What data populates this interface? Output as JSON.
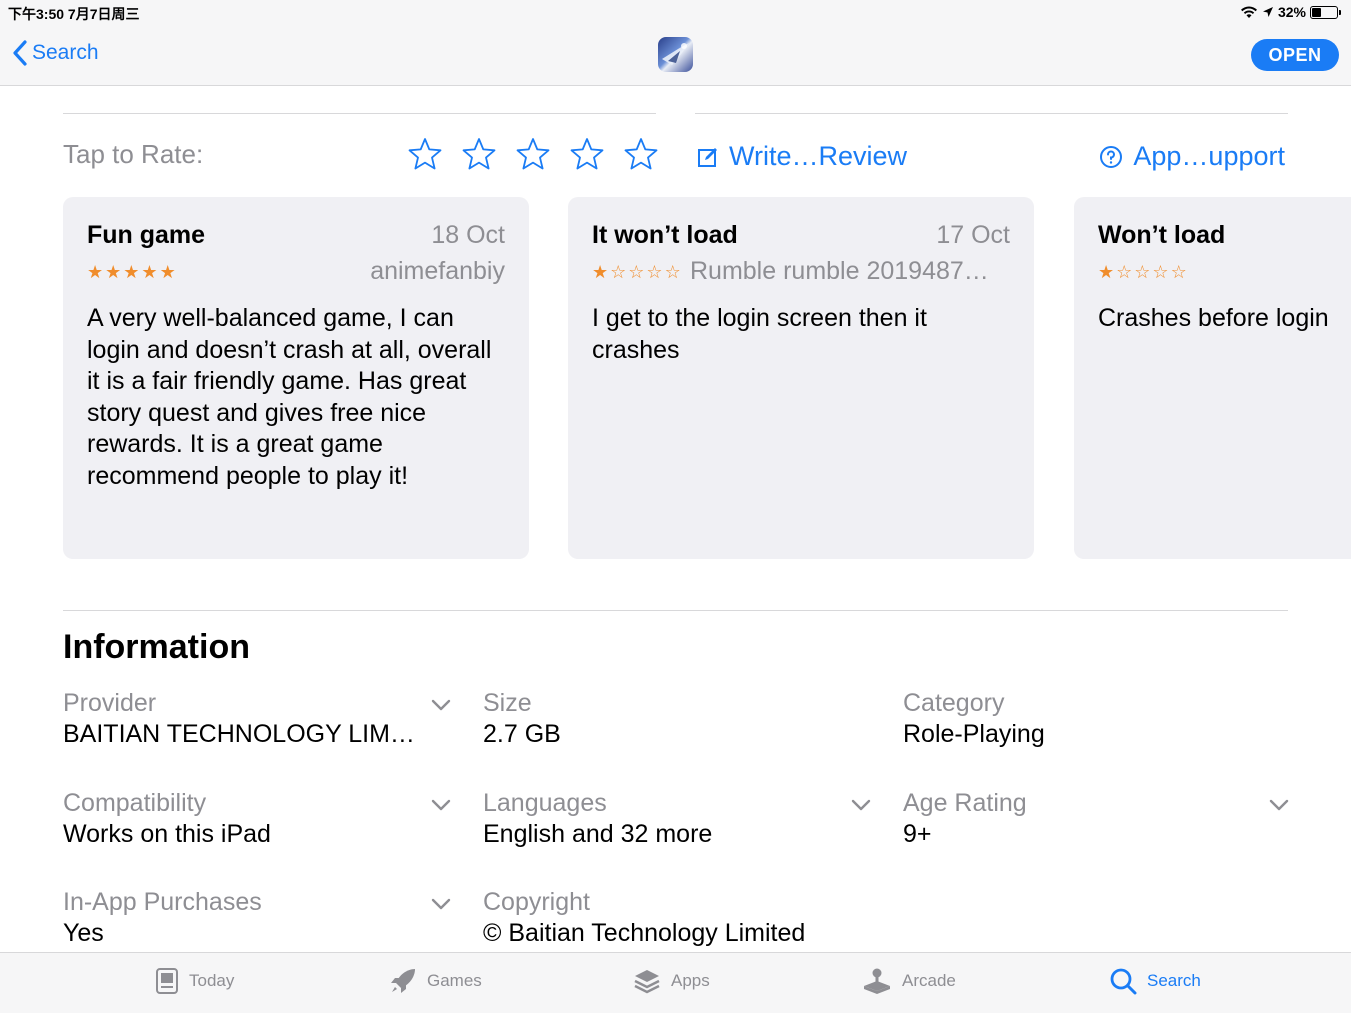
{
  "status": {
    "time": "下午3:50   7月7日周三",
    "battery": "32%"
  },
  "nav": {
    "back_label": "Search",
    "open_label": "OPEN"
  },
  "rate": {
    "tap_label": "Tap to Rate:",
    "write_review": "Write…Review",
    "app_support": "App…upport"
  },
  "reviews": [
    {
      "title": "Fun game",
      "date": "18 Oct",
      "author": "animefanbiy",
      "rating": 5,
      "body": "A very well-balanced game, I can login and doesn’t crash at all, overall it is a fair friendly game. Has great story quest and gives free nice rewards. It is a great game recommend people to play it!"
    },
    {
      "title": "It won’t load",
      "date": "17 Oct",
      "author": "Rumble rumble 2019487…",
      "rating": 1,
      "body": "I get to the login screen then it crashes"
    },
    {
      "title": "Won’t load",
      "date": "",
      "author": "",
      "rating": 1,
      "body": "Crashes before login"
    }
  ],
  "information": {
    "title": "Information",
    "items": [
      {
        "label": "Provider",
        "value": "BAITIAN TECHNOLOGY LIM…"
      },
      {
        "label": "Size",
        "value": "2.7 GB"
      },
      {
        "label": "Category",
        "value": "Role-Playing"
      },
      {
        "label": "Compatibility",
        "value": "Works on this iPad"
      },
      {
        "label": "Languages",
        "value": "English and 32 more"
      },
      {
        "label": "Age Rating",
        "value": "9+"
      },
      {
        "label": "In-App Purchases",
        "value": "Yes"
      },
      {
        "label": "Copyright",
        "value": "© Baitian Technology Limited"
      }
    ]
  },
  "tabs": [
    {
      "label": "Today",
      "icon": "today-icon"
    },
    {
      "label": "Games",
      "icon": "rocket-icon"
    },
    {
      "label": "Apps",
      "icon": "layers-icon"
    },
    {
      "label": "Arcade",
      "icon": "joystick-icon"
    },
    {
      "label": "Search",
      "icon": "search-icon"
    }
  ],
  "colors": {
    "accent": "#1a7cf5",
    "star": "#f08d2c",
    "secondary": "#8e8e93",
    "card_bg": "#f0f0f4"
  }
}
